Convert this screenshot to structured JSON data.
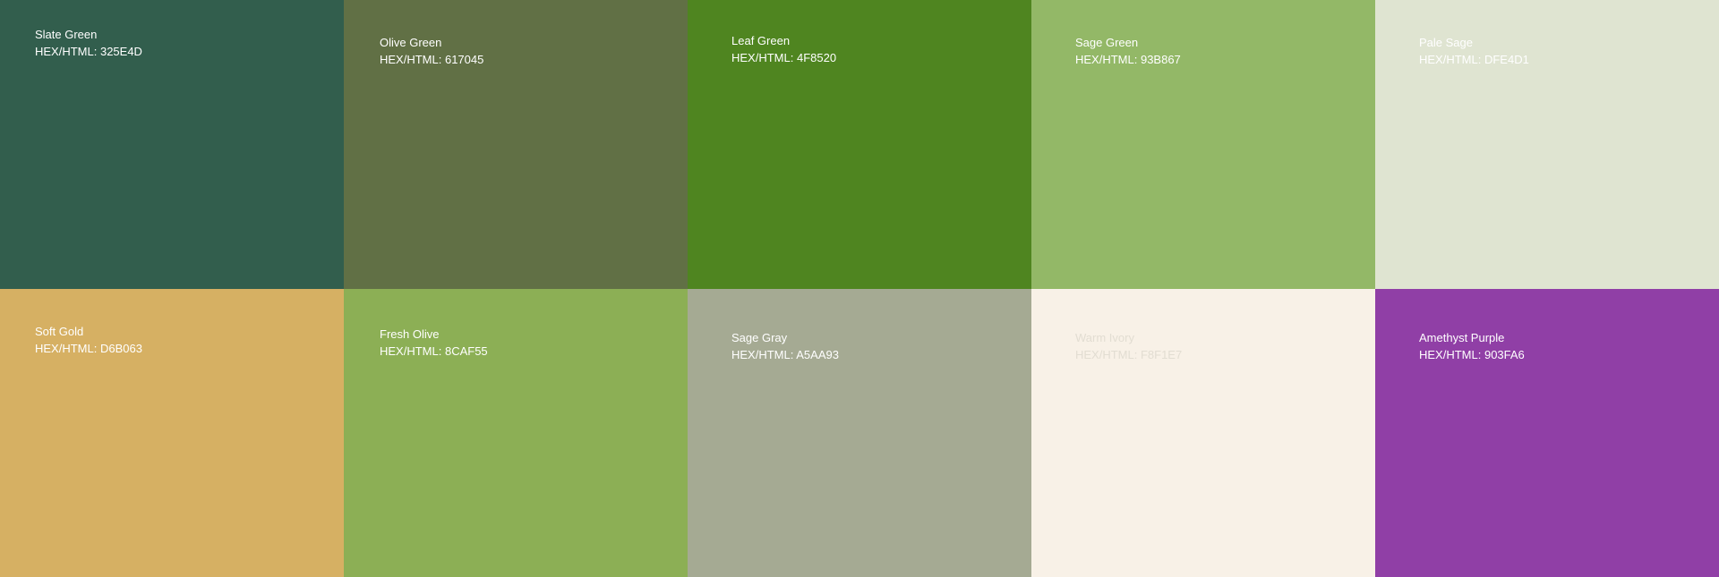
{
  "hex_prefix": "HEX/HTML: ",
  "swatches": [
    {
      "name": "Slate Green",
      "hex": "325E4D",
      "color": "#325E4D",
      "text_color": "#FFFFFF"
    },
    {
      "name": "Olive Green",
      "hex": "617045",
      "color": "#617045",
      "text_color": "#FFFFFF"
    },
    {
      "name": "Leaf Green",
      "hex": "4F8520",
      "color": "#4F8520",
      "text_color": "#FFFFFF"
    },
    {
      "name": "Sage Green",
      "hex": "93B867",
      "color": "#93B867",
      "text_color": "#FFFFFF"
    },
    {
      "name": "Pale Sage",
      "hex": "DFE4D1",
      "color": "#DFE4D1",
      "text_color": "#FFFFFF"
    },
    {
      "name": "Soft Gold",
      "hex": "D6B063",
      "color": "#D6B063",
      "text_color": "#FFFFFF"
    },
    {
      "name": "Fresh Olive",
      "hex": "8CAF55",
      "color": "#8CAF55",
      "text_color": "#FFFFFF"
    },
    {
      "name": "Sage Gray",
      "hex": "A5AA93",
      "color": "#A5AA93",
      "text_color": "#FFFFFF"
    },
    {
      "name": "Warm Ivory",
      "hex": "F8F1E7",
      "color": "#F8F1E7",
      "text_color": "#E2DDD2"
    },
    {
      "name": "Amethyst Purple",
      "hex": "903FA6",
      "color": "#903FA6",
      "text_color": "#FFFFFF"
    }
  ]
}
